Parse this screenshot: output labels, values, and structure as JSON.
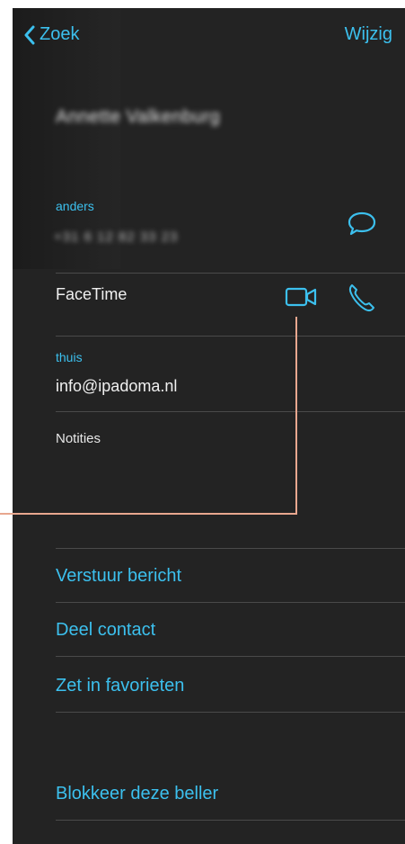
{
  "nav": {
    "back_label": "Zoek",
    "edit_label": "Wijzig"
  },
  "contact": {
    "name": "Annette Valkenburg",
    "other_label": "anders",
    "other_phone": "+31 6 12 82 33 23",
    "facetime_label": "FaceTime",
    "home_label": "thuis",
    "email": "info@ipadoma.nl",
    "notes_label": "Notities"
  },
  "actions": {
    "send_message": "Verstuur bericht",
    "share_contact": "Deel contact",
    "add_favorite": "Zet in favorieten",
    "block_caller": "Blokkeer deze beller"
  },
  "colors": {
    "accent": "#3cc0ee",
    "background": "#232323",
    "divider": "#4a4a4a",
    "annotation": "#e8a78f"
  },
  "icons": {
    "back": "chevron-left-icon",
    "message": "message-bubble-icon",
    "video": "video-camera-icon",
    "phone": "phone-icon"
  }
}
